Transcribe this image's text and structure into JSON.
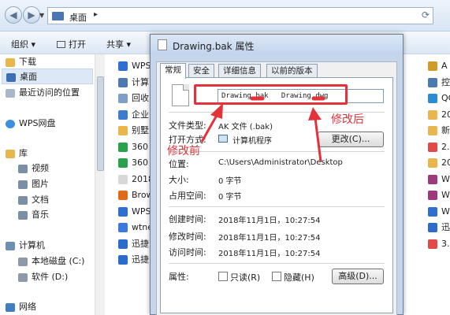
{
  "address": {
    "path": "桌面",
    "separator": "▸"
  },
  "toolbar": {
    "organize": "组织 ▾",
    "open": "打开",
    "share": "共享 ▾"
  },
  "sidebar": {
    "items": [
      {
        "label": "下载",
        "color": "#e8b64c"
      },
      {
        "label": "桌面",
        "color": "#3e6fb3"
      },
      {
        "label": "最近访问的位置",
        "color": "#a7b8cc"
      },
      {
        "label": "WPS网盘",
        "color": "#3d8fe0"
      },
      {
        "label": "库",
        "color": "#e8b64c"
      },
      {
        "label": "视频",
        "color": "#7a8ea6"
      },
      {
        "label": "图片",
        "color": "#7a8ea6"
      },
      {
        "label": "文档",
        "color": "#7a8ea6"
      },
      {
        "label": "音乐",
        "color": "#7a8ea6"
      },
      {
        "label": "计算机",
        "color": "#6d8fb3"
      },
      {
        "label": "本地磁盘 (C:)",
        "color": "#8d9aab"
      },
      {
        "label": "软件 (D:)",
        "color": "#8d9aab"
      },
      {
        "label": "网络",
        "color": "#3e7fc4"
      }
    ]
  },
  "files": {
    "left": [
      {
        "label": "WPS",
        "color": "#2f6fd0"
      },
      {
        "label": "计算",
        "color": "#4c79b2"
      },
      {
        "label": "回收",
        "color": "#7ea0c8"
      },
      {
        "label": "企业",
        "color": "#3d7dcc"
      },
      {
        "label": "别墅",
        "color": "#e8b64c"
      },
      {
        "label": "360",
        "color": "#2aa14a"
      },
      {
        "label": "360",
        "color": "#2aa14a"
      },
      {
        "label": "2018",
        "color": "#d8d8d8"
      },
      {
        "label": "Brow",
        "color": "#e06a1c"
      },
      {
        "label": "WPS",
        "color": "#2f6fd0"
      },
      {
        "label": "wtne",
        "color": "#3b7ad8"
      },
      {
        "label": "迅捷",
        "color": "#2c6bc9"
      },
      {
        "label": "迅捷",
        "color": "#2c6bc9"
      }
    ],
    "right": [
      {
        "label": "A",
        "color": "#d39a2a"
      },
      {
        "label": "控",
        "color": "#4c79b2"
      },
      {
        "label": "QC",
        "color": "#2b8cd6"
      },
      {
        "label": "20",
        "color": "#e8b64c"
      },
      {
        "label": "新",
        "color": "#e8b64c"
      },
      {
        "label": "2.",
        "color": "#e24a4a"
      },
      {
        "label": "20",
        "color": "#e8b64c"
      },
      {
        "label": "Wi",
        "color": "#9c3a7a"
      },
      {
        "label": "Wi",
        "color": "#9c3a7a"
      },
      {
        "label": "Wi",
        "color": "#2f6fd0"
      },
      {
        "label": "迅",
        "color": "#2c6bc9"
      },
      {
        "label": "3.",
        "color": "#e24a4a"
      }
    ]
  },
  "dialog": {
    "title": "Drawing.bak 属性",
    "tabs": [
      "常规",
      "安全",
      "详细信息",
      "以前的版本"
    ],
    "filename": "Drawing.bak   Drawing.dwg",
    "file_type_label": "文件类型:",
    "file_type_value": "AK 文件 (.bak)",
    "open_with_label": "打开方式:",
    "open_with_value": "计算机程序",
    "change_button": "更改(C)...",
    "location_label": "位置:",
    "location_value": "C:\\Users\\Administrator\\Desktop",
    "size_label": "大小:",
    "size_value": "0 字节",
    "disk_size_label": "占用空间:",
    "disk_size_value": "0 字节",
    "created_label": "创建时间:",
    "created_value": "2018年11月1日，10:27:54",
    "modified_label": "修改时间:",
    "modified_value": "2018年11月1日，10:27:54",
    "accessed_label": "访问时间:",
    "accessed_value": "2018年11月1日，10:27:54",
    "attributes_label": "属性:",
    "readonly_label": "只读(R)",
    "hidden_label": "隐藏(H)",
    "advanced_button": "高级(D)..."
  },
  "annotations": {
    "before": "修改前",
    "after": "修改后",
    "color": "#e4323a"
  }
}
